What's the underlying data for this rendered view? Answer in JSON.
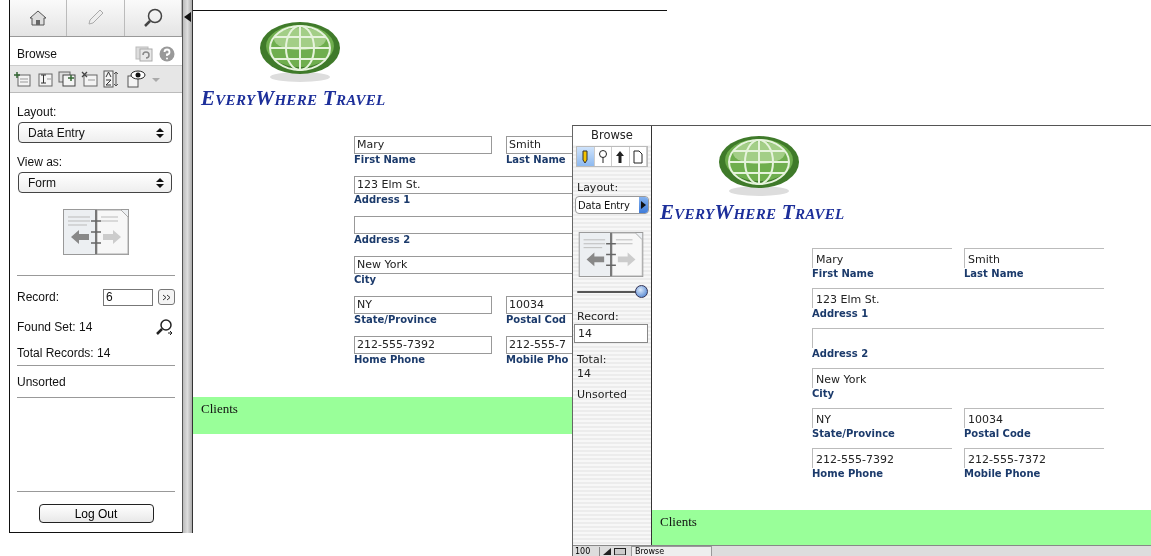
{
  "window_1": {
    "sidebar": {
      "mode": "Browse",
      "layout_label": "Layout:",
      "layout_value": "Data Entry",
      "view_label": "View as:",
      "view_value": "Form",
      "record_label": "Record:",
      "record_value": "6",
      "found_set": "Found Set: 14",
      "total_records": "Total Records: 14",
      "sort_status": "Unsorted",
      "logout_button": "Log Out"
    },
    "document": {
      "brand": "EveryWhere Travel",
      "rows": [
        {
          "fields": [
            {
              "label": "First Name",
              "value": "Mary"
            },
            {
              "label": "Last Name",
              "value": "Smith"
            }
          ]
        },
        {
          "fields": [
            {
              "label": "Address 1",
              "value": "123 Elm St.",
              "wide": true
            }
          ]
        },
        {
          "fields": [
            {
              "label": "Address 2",
              "wide": true
            }
          ]
        },
        {
          "fields": [
            {
              "label": "City",
              "value": "New York",
              "wide": true
            }
          ]
        },
        {
          "fields": [
            {
              "label": "State/Province",
              "value": "NY"
            },
            {
              "label": "Postal Cod",
              "value": "10034"
            }
          ]
        },
        {
          "fields": [
            {
              "label": "Home Phone",
              "value": "212-555-7392"
            },
            {
              "label": "Mobile Pho",
              "value": "212-555-7"
            }
          ]
        }
      ],
      "footer": "Clients"
    }
  },
  "window_2": {
    "sidebar": {
      "mode": "Browse",
      "mode_buttons": [
        {
          "kind": "pencil",
          "selected": true
        },
        {
          "kind": "pin",
          "selected": false
        },
        {
          "kind": "arrow",
          "selected": false
        },
        {
          "kind": "page",
          "selected": false
        }
      ],
      "layout_label": "Layout:",
      "layout_value": "Data Entry",
      "slider": {
        "level": 1
      },
      "record_label": "Record:",
      "record_value": "14",
      "total_label": "Total:",
      "total_value": "14",
      "sort_status": "Unsorted"
    },
    "document": {
      "brand": "EveryWhere Travel",
      "rows": [
        {
          "fields": [
            {
              "label": "First Name",
              "value": "Mary"
            },
            {
              "label": "Last Name",
              "value": "Smith"
            }
          ]
        },
        {
          "fields": [
            {
              "label": "Address 1",
              "value": "123 Elm St.",
              "wide": true
            }
          ]
        },
        {
          "fields": [
            {
              "label": "Address 2",
              "wide": true
            }
          ]
        },
        {
          "fields": [
            {
              "label": "City",
              "value": "New York",
              "wide": true
            }
          ]
        },
        {
          "fields": [
            {
              "label": "State/Province",
              "value": "NY"
            },
            {
              "label": "Postal Code",
              "value": "10034"
            }
          ]
        },
        {
          "fields": [
            {
              "label": "Home Phone",
              "value": "212-555-7392"
            },
            {
              "label": "Mobile Phone",
              "value": "212-555-7372"
            }
          ]
        }
      ],
      "footer": "Clients"
    },
    "status_bar": {
      "zoom": "100",
      "mode": "Browse"
    }
  }
}
